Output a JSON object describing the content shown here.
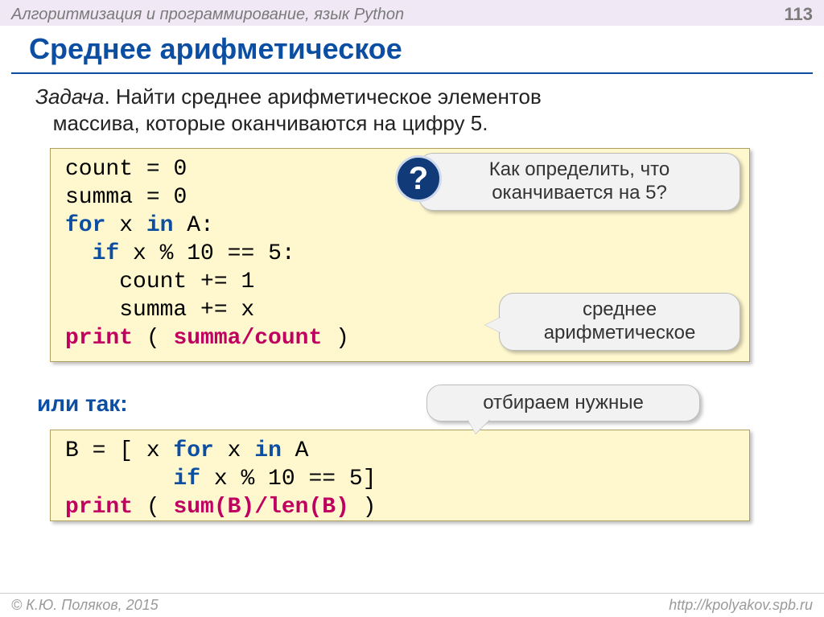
{
  "header": {
    "subject": "Алгоритмизация и программирование, язык Python",
    "page_number": "113"
  },
  "title": "Среднее арифметическое",
  "task": {
    "label": "Задача",
    "text": ". Найти среднее арифметическое элементов\n   массива, которые оканчиваются на цифру 5."
  },
  "code1": {
    "tokens": [
      {
        "t": "count",
        "c": "id"
      },
      {
        "t": " = ",
        "c": "op"
      },
      {
        "t": "0",
        "c": "num"
      },
      {
        "t": "\n",
        "c": ""
      },
      {
        "t": "summa",
        "c": "id"
      },
      {
        "t": " = ",
        "c": "op"
      },
      {
        "t": "0",
        "c": "num"
      },
      {
        "t": "\n",
        "c": ""
      },
      {
        "t": "for",
        "c": "kw"
      },
      {
        "t": " x ",
        "c": "id"
      },
      {
        "t": "in",
        "c": "kw"
      },
      {
        "t": " A:",
        "c": "id"
      },
      {
        "t": "\n",
        "c": ""
      },
      {
        "t": "  ",
        "c": ""
      },
      {
        "t": "if",
        "c": "kw"
      },
      {
        "t": " x % ",
        "c": "id"
      },
      {
        "t": "10",
        "c": "num"
      },
      {
        "t": " == ",
        "c": "op"
      },
      {
        "t": "5",
        "c": "num"
      },
      {
        "t": ":",
        "c": "op"
      },
      {
        "t": "\n",
        "c": ""
      },
      {
        "t": "    count += ",
        "c": "id"
      },
      {
        "t": "1",
        "c": "num"
      },
      {
        "t": "\n",
        "c": ""
      },
      {
        "t": "    summa += x",
        "c": "id"
      },
      {
        "t": "\n",
        "c": ""
      },
      {
        "t": "print",
        "c": "builtin"
      },
      {
        "t": " ( ",
        "c": "op"
      },
      {
        "t": "summa/count",
        "c": "hl"
      },
      {
        "t": " )",
        "c": "op"
      }
    ]
  },
  "or_label": "или так:",
  "code2": {
    "tokens": [
      {
        "t": "B = [ x ",
        "c": "id"
      },
      {
        "t": "for",
        "c": "kw"
      },
      {
        "t": " x ",
        "c": "id"
      },
      {
        "t": "in",
        "c": "kw"
      },
      {
        "t": " A",
        "c": "id"
      },
      {
        "t": "\n",
        "c": ""
      },
      {
        "t": "        ",
        "c": ""
      },
      {
        "t": "if",
        "c": "kw"
      },
      {
        "t": " x % ",
        "c": "id"
      },
      {
        "t": "10",
        "c": "num"
      },
      {
        "t": " == ",
        "c": "op"
      },
      {
        "t": "5",
        "c": "num"
      },
      {
        "t": "]",
        "c": "op"
      },
      {
        "t": "\n",
        "c": ""
      },
      {
        "t": "print",
        "c": "builtin"
      },
      {
        "t": " ( ",
        "c": "op"
      },
      {
        "t": "sum(B)/len(B)",
        "c": "hl"
      },
      {
        "t": " )",
        "c": "op"
      }
    ]
  },
  "callouts": {
    "question_badge": "?",
    "question": "Как определить, что оканчивается на 5?",
    "mean": "среднее арифметическое",
    "select": "отбираем нужные"
  },
  "footer": {
    "copyright": "© К.Ю. Поляков, 2015",
    "url": "http://kpolyakov.spb.ru"
  }
}
